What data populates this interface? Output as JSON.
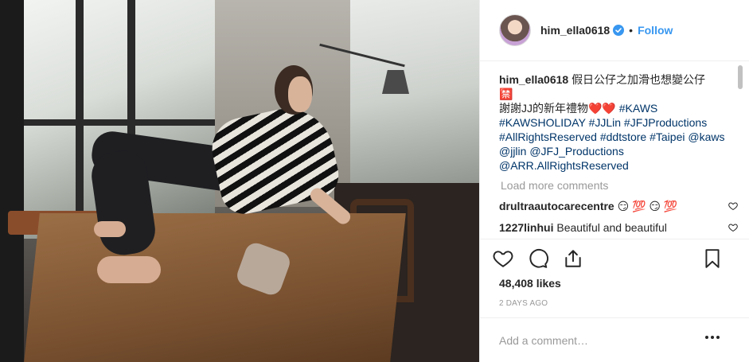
{
  "post": {
    "photo_alt": "Woman in striped shirt doing a reverse tabletop pose on a wooden table",
    "header": {
      "username": "him_ella0618",
      "separator": "•",
      "follow_label": "Follow",
      "verified_icon": "verified-badge-icon",
      "verified_color": "#3897f0"
    },
    "caption": {
      "username": "him_ella0618",
      "text_line1": "假日公仔之加滑也想變公仔",
      "emoji_line": "🈲",
      "text_line2": "謝謝JJ的新年禮物",
      "hearts": "❤️❤️",
      "tags": [
        "#KAWS",
        "#KAWSHOLIDAY",
        "#JJLin",
        "#JFJProductions",
        "#AllRightsReserved",
        "#ddtstore",
        "#Taipei",
        "@kaws",
        "@jjlin",
        "@JFJ_Productions",
        "@ARR.AllRightsReserved"
      ]
    },
    "load_more_label": "Load more comments",
    "comments": [
      {
        "username": "drultraautocarecentre",
        "text": "😏 💯 😏 💯"
      },
      {
        "username": "1227linhui",
        "text": "Beautiful and beautiful"
      }
    ],
    "actions": {
      "like_icon": "heart-icon",
      "comment_icon": "comment-icon",
      "share_icon": "share-icon",
      "save_icon": "bookmark-icon"
    },
    "likes_label": "48,408 likes",
    "timestamp": "2 DAYS AGO",
    "add_comment_placeholder": "Add a comment…",
    "more_options_icon": "ellipsis-icon",
    "colors": {
      "link": "#003569",
      "accent": "#3897f0",
      "muted": "#999999",
      "text": "#262626"
    }
  }
}
